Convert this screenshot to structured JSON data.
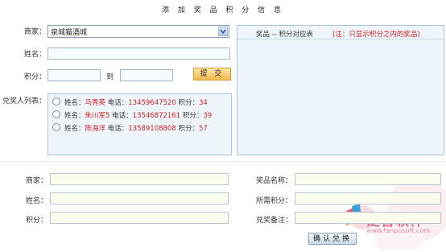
{
  "page": {
    "title": "添 加 奖 品 积 分 信 息"
  },
  "form": {
    "merchant_label": "商家：",
    "merchant_value": "泉城猫酒城",
    "name_label": "姓名：",
    "points_label": "积分：",
    "to_label": "到",
    "submit_label": "提 交",
    "winners_label": "兑奖人列表："
  },
  "winners": [
    {
      "name_label": "姓名：",
      "name": "马秀英",
      "phone_label": "电话：",
      "phone": "13459647520",
      "points_label": "积分：",
      "points": "34"
    },
    {
      "name_label": "姓名：",
      "name": "朱川军5",
      "phone_label": "电话：",
      "phone": "13546872161",
      "points_label": "积分：",
      "points": "39"
    },
    {
      "name_label": "姓名：",
      "name": "陈海洋",
      "phone_label": "电话：",
      "phone": "13589108808",
      "points_label": "积分：",
      "points": "57"
    }
  ],
  "prize_table": {
    "header": "奖品 -- 积分对应表",
    "note": "(注：只显示积分之内的奖品)"
  },
  "bottom": {
    "merchant_label": "商家：",
    "name_label": "姓名：",
    "points_label": "积分：",
    "prize_name_label": "奖品名称：",
    "required_points_label": "所需积分：",
    "remark_label": "兑奖备注：",
    "confirm_label": "确认兑换"
  },
  "watermark": {
    "brand": "泛普软件",
    "url": "www.fanpusoft.com"
  },
  "colors": {
    "accent_red": "#d21d1d",
    "submit_orange": "#f3b74e",
    "panel_blue": "#eef6fb",
    "border_blue": "#a9c6dc"
  }
}
